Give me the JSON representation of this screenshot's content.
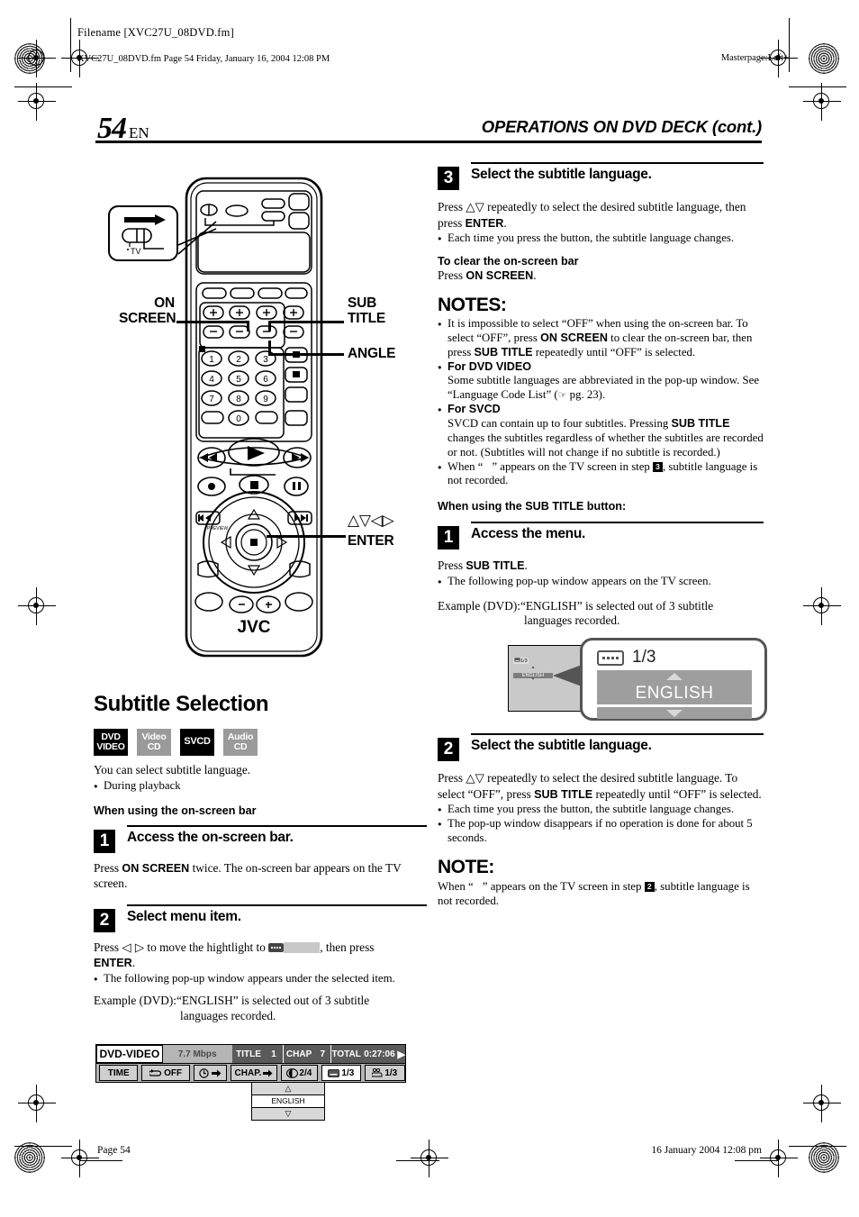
{
  "printmarks": {
    "filename_label": "Filename [XVC27U_08DVD.fm]",
    "framemaker_line": "XVC27U_08DVD.fm  Page 54  Friday, January 16, 2004  12:08 PM",
    "masterpage": "Masterpage:Left+"
  },
  "header": {
    "page_number": "54",
    "page_number_suffix": "EN",
    "chapter_title": "OPERATIONS ON DVD DECK (cont.)"
  },
  "remote": {
    "tv_switch_label": "TV",
    "brand": "JVC",
    "labels": {
      "on_screen": "ON\nSCREEN",
      "on_screen_l1": "ON",
      "on_screen_l2": "SCREEN",
      "sub_title_l1": "SUB",
      "sub_title_l2": "TITLE",
      "angle": "ANGLE",
      "enter_arrows": "△▽◁▷",
      "enter": "ENTER"
    },
    "keypad": [
      "1",
      "2",
      "3",
      "4",
      "5",
      "6",
      "7",
      "8",
      "9",
      "0"
    ]
  },
  "left_column": {
    "section_title": "Subtitle Selection",
    "badges": [
      {
        "line1": "DVD",
        "line2": "VIDEO",
        "active": true
      },
      {
        "line1": "Video",
        "line2": "CD",
        "active": false
      },
      {
        "line1": "SVCD",
        "line2": "",
        "active": true
      },
      {
        "line1": "Audio",
        "line2": "CD",
        "active": false
      }
    ],
    "intro": "You can select subtitle language.",
    "intro_bullets": [
      "During playback"
    ],
    "method_heading": "When using the on-screen bar",
    "step1": {
      "num": "1",
      "title": "Access the on-screen bar.",
      "body_pre": "Press ",
      "body_bold": "ON SCREEN",
      "body_post": " twice. The on-screen bar appears on the TV screen."
    },
    "step2": {
      "num": "2",
      "title": "Select menu item.",
      "body_pre": "Press ",
      "arrows": "◁ ▷",
      "body_mid": " to move the hightlight to ",
      "body_mid2": ", then press ",
      "body_bold": "ENTER",
      "body_post": ".",
      "bullets": [
        "The following pop-up window appears under the selected item."
      ],
      "example_label": "Example (DVD):",
      "example_text": "“ENGLISH” is selected out of 3 subtitle",
      "example_text2": "languages recorded."
    },
    "onscreen_bar": {
      "disc_type": "DVD-VIDEO",
      "bitrate": "7.7 Mbps",
      "title_label": "TITLE",
      "title_value": "1",
      "chap_label": "CHAP",
      "chap_value": "7",
      "total_label": "TOTAL",
      "total_value": "0:27:06",
      "play_icon": "▶",
      "row2": [
        {
          "label": "TIME"
        },
        {
          "label": "OFF",
          "icon": "repeat"
        },
        {
          "label": "",
          "icon": "clock-arrow"
        },
        {
          "label": "CHAP.",
          "icon": "arrow"
        },
        {
          "label": "2/4",
          "icon": "audio"
        },
        {
          "label": "1/3",
          "icon": "subtitle",
          "selected": true
        },
        {
          "label": "1/3",
          "icon": "angle"
        }
      ],
      "popup": {
        "up": "△",
        "value": "ENGLISH",
        "down": "▽"
      }
    }
  },
  "right_column": {
    "step3": {
      "num": "3",
      "title": "Select the subtitle language.",
      "body_pre": "Press ",
      "arrows": "△▽",
      "body_mid": " repeatedly to select the desired subtitle language, then press ",
      "body_bold": "ENTER",
      "body_post": ".",
      "bullets": [
        "Each time you press the button, the subtitle language changes."
      ],
      "clear_heading": "To clear the on-screen bar",
      "clear_pre": "Press ",
      "clear_bold": "ON SCREEN",
      "clear_post": "."
    },
    "notes_heading": "NOTES:",
    "notes": [
      {
        "type": "plain",
        "parts": [
          {
            "t": "It is impossible to select “OFF” when using the on-screen bar. To select “OFF”, press "
          },
          {
            "t": "ON SCREEN",
            "b": true
          },
          {
            "t": " to clear the on-screen bar, then press "
          },
          {
            "t": "SUB TITLE",
            "b": true
          },
          {
            "t": " repeatedly until “OFF” is selected."
          }
        ]
      },
      {
        "type": "titled",
        "title": "For DVD VIDEO",
        "parts": [
          {
            "t": "Some subtitle languages are abbreviated in the pop-up window. See “Language Code List” ("
          },
          {
            "t": "☞",
            "icon": true
          },
          {
            "t": " pg. 23)."
          }
        ]
      },
      {
        "type": "titled",
        "title": "For SVCD",
        "parts": [
          {
            "t": "SVCD can contain up to four subtitles. Pressing "
          },
          {
            "t": "SUB TITLE",
            "b": true
          },
          {
            "t": " changes the subtitles regardless of whether the subtitles are recorded or not. (Subtitles will not change if no subtitle is recorded.)"
          }
        ]
      },
      {
        "type": "step_ref",
        "parts": [
          {
            "t": "When “⃠” appears on the TV screen in step "
          },
          {
            "t": "3",
            "step": true
          },
          {
            "t": ", subtitle language is not recorded."
          }
        ]
      }
    ],
    "method_heading": "When using the SUB TITLE button:",
    "step1": {
      "num": "1",
      "title": "Access the menu.",
      "body_pre": "Press ",
      "body_bold": "SUB TITLE",
      "body_post": ".",
      "bullets": [
        "The following pop-up window appears on the TV screen."
      ],
      "example_label": "Example (DVD):",
      "example_text": "“ENGLISH” is selected out of 3 subtitle",
      "example_text2": "languages recorded."
    },
    "tv_popup": {
      "fraction": "1/3",
      "up_arrow": "▲",
      "language": "ENGLISH",
      "down_arrow": "▼",
      "mini_fraction": "1/3",
      "mini_language": "ENGLISH"
    },
    "step2": {
      "num": "2",
      "title": "Select the subtitle language.",
      "body_pre": "Press ",
      "arrows": "△▽",
      "body_mid": " repeatedly to select the desired subtitle language. To select “OFF”, press ",
      "body_bold": "SUB TITLE",
      "body_post": " repeatedly until “OFF” is selected.",
      "bullets": [
        "Each time you press the button, the subtitle language changes.",
        "The pop-up window disappears if no operation is done for about 5 seconds."
      ]
    },
    "note_heading": "NOTE:",
    "note_parts": [
      {
        "t": "When “⃠” appears on the TV screen in step "
      },
      {
        "t": "2",
        "step": true
      },
      {
        "t": ", subtitle language is not recorded."
      }
    ]
  },
  "footer": {
    "left": "Page 54",
    "right": "16 January 2004 12:08 pm"
  },
  "colors": {
    "ink": "#000000",
    "badge_active": "#000000",
    "badge_inactive": "#9a9a9a",
    "osb_bg": "#b5b5b5",
    "popup_gray": "#9e9e9e"
  }
}
